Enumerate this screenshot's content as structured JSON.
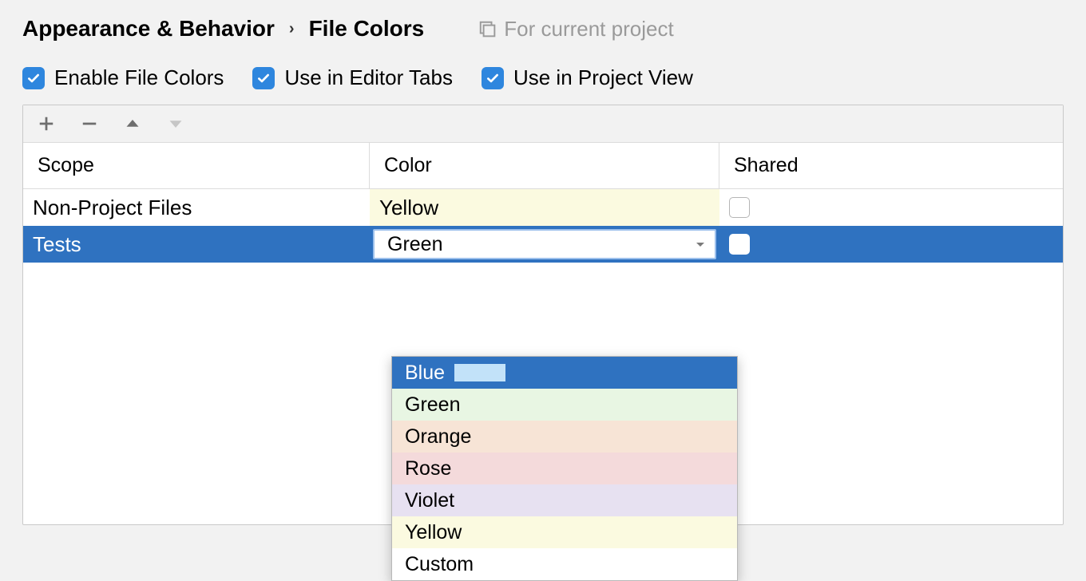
{
  "breadcrumb": {
    "parent": "Appearance & Behavior",
    "current": "File Colors"
  },
  "hint": "For current project",
  "checks": {
    "enable": "Enable File Colors",
    "editor_tabs": "Use in Editor Tabs",
    "project_view": "Use in Project View"
  },
  "table": {
    "headers": {
      "scope": "Scope",
      "color": "Color",
      "shared": "Shared"
    },
    "rows": [
      {
        "scope": "Non-Project Files",
        "color": "Yellow",
        "shared": false
      },
      {
        "scope": "Tests",
        "color": "Green",
        "shared": false
      }
    ]
  },
  "dropdown": {
    "selected": "Blue",
    "items": [
      {
        "label": "Blue"
      },
      {
        "label": "Green"
      },
      {
        "label": "Orange"
      },
      {
        "label": "Rose"
      },
      {
        "label": "Violet"
      },
      {
        "label": "Yellow"
      },
      {
        "label": "Custom"
      }
    ]
  }
}
